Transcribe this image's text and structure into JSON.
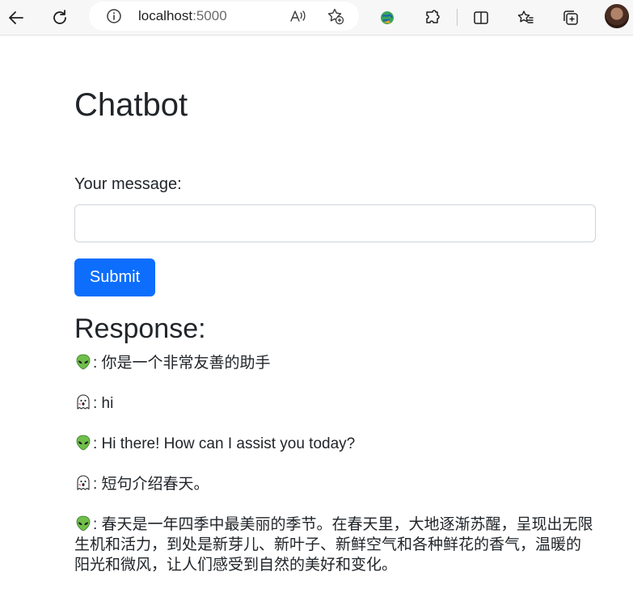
{
  "browser": {
    "url_host": "localhost",
    "url_port": ":5000",
    "icons": [
      "back-icon",
      "refresh-icon",
      "info-icon",
      "read-aloud-icon",
      "add-favorite-icon",
      "extension-globe-icon",
      "extensions-icon",
      "split-screen-icon",
      "favorites-icon",
      "collections-icon",
      "profile-avatar"
    ]
  },
  "page": {
    "title": "Chatbot",
    "message_label": "Your message:",
    "message_value": "",
    "submit_label": "Submit",
    "response_heading": "Response:"
  },
  "messages": [
    {
      "role": "system",
      "icon": "alien-icon",
      "text": ": 你是一个非常友善的助手"
    },
    {
      "role": "user",
      "icon": "ghost-icon",
      "text": ": hi"
    },
    {
      "role": "assistant",
      "icon": "alien-icon",
      "text": ": Hi there! How can I assist you today?"
    },
    {
      "role": "user",
      "icon": "ghost-icon",
      "text": ": 短句介绍春天。"
    },
    {
      "role": "assistant",
      "icon": "alien-icon",
      "text": ": 春天是一年四季中最美丽的季节。在春天里，大地逐渐苏醒，呈现出无限生机和活力，到处是新芽儿、新叶子、新鲜空气和各种鲜花的香气，温暖的阳光和微风，让人们感受到自然的美好和变化。"
    }
  ],
  "colors": {
    "accent": "#0d6efd",
    "text": "#212529",
    "alien": "#6fbf4a"
  }
}
